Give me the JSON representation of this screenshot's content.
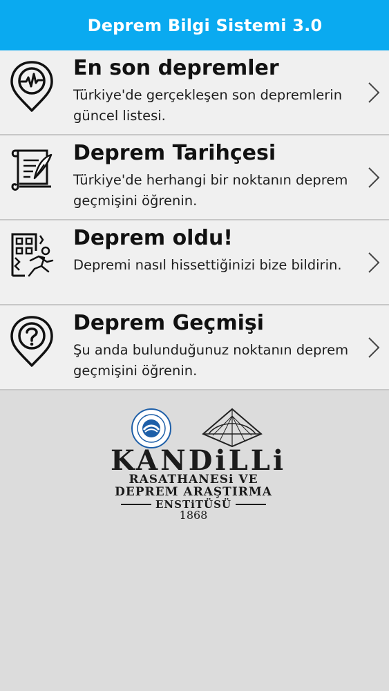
{
  "app_bar": {
    "title": "Deprem Bilgi Sistemi 3.0",
    "color": "#0aaaf0"
  },
  "menu": {
    "items": [
      {
        "title": "En son depremler",
        "description": "Türkiye'de gerçekleşen son depremlerin güncel listesi.",
        "icon": "seismograph-pin-icon"
      },
      {
        "title": "Deprem Tarihçesi",
        "description": "Türkiye'de herhangi bir noktanın deprem geçmişini öğrenin.",
        "icon": "scroll-quill-icon"
      },
      {
        "title": "Deprem oldu!",
        "description": "Depremi nasıl hissettiğinizi bize bildirin.",
        "icon": "building-running-person-icon"
      },
      {
        "title": "Deprem Geçmişi",
        "description": "Şu anda bulunduğunuz noktanın deprem geçmişini öğrenin.",
        "icon": "question-pin-icon"
      }
    ]
  },
  "logo": {
    "brand": "KANDiLLi",
    "line1": "RASATHANESi VE",
    "line2": "DEPREM ARAŞTIRMA",
    "line3": "ENSTiTÜSÜ",
    "year": "1868",
    "seal_color": "#1e5fa8"
  }
}
